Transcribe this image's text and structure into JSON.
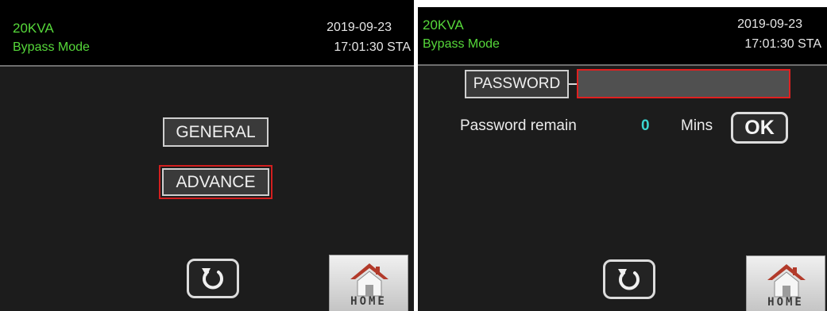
{
  "left_screen": {
    "header": {
      "model": "20KVA",
      "mode": "Bypass Mode",
      "date": "2019-09-23",
      "time": "17:01:30 STA"
    },
    "menu": {
      "general_label": "GENERAL",
      "advance_label": "ADVANCE",
      "selected": "ADVANCE"
    },
    "nav": {
      "back_icon": "back-icon",
      "home_label": "HOME"
    }
  },
  "right_screen": {
    "header": {
      "model": "20KVA",
      "mode": "Bypass Mode",
      "date": "2019-09-23",
      "time": "17:01:30 STA"
    },
    "password": {
      "label": "PASSWORD",
      "value": "",
      "remain_label": "Password remain",
      "remain_value": "0",
      "remain_unit": "Mins",
      "ok_label": "OK"
    },
    "nav": {
      "back_icon": "back-icon",
      "home_label": "HOME"
    }
  },
  "colors": {
    "status_text": "#56d83a",
    "selection_border": "#d21f1f",
    "remain_value": "#3bd5d0",
    "screen_bg": "#1c1c1c",
    "header_bg": "#000000"
  }
}
